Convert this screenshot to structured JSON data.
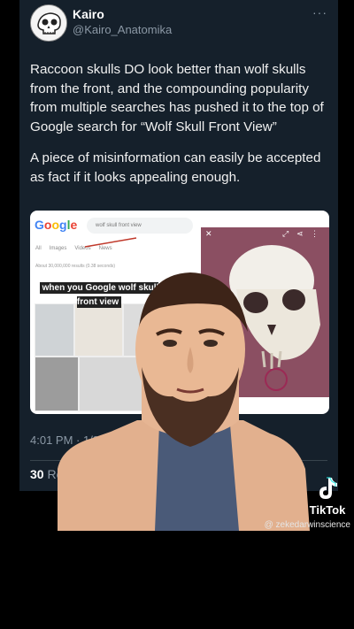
{
  "tweet": {
    "author_name": "Kairo",
    "author_handle": "@Kairo_Anatomika",
    "more_icon": "ellipsis-icon",
    "paragraphs": [
      "Raccoon skulls DO look better than wolf skulls from the front, and the compounding popularity from multiple searches has pushed it to the top of Google search for “Wolf Skull Front View”",
      "A piece of misinformation can easily be accepted as fact if it looks appealing enough."
    ],
    "timestamp": "4:01 PM · 1/9/24 fr",
    "repost_count": "30",
    "repost_label": "Repost"
  },
  "embedded_screenshot": {
    "google_logo": "Google",
    "search_query": "wolf skull front view",
    "tabs": [
      "All",
      "Images",
      "Videos",
      "News"
    ],
    "results_meta": "About 30,000,000 results (0.38 seconds)",
    "meme_caption": "when you Google wolf skull front view"
  },
  "overlay": {
    "tiktok_label": "TikTok",
    "tiktok_username": "@ zekedarwinscience"
  },
  "colors": {
    "card_bg": "#15202b",
    "text_primary": "#e7e9ea",
    "text_secondary": "#8b98a5",
    "preview_bg": "#8b4f62"
  }
}
